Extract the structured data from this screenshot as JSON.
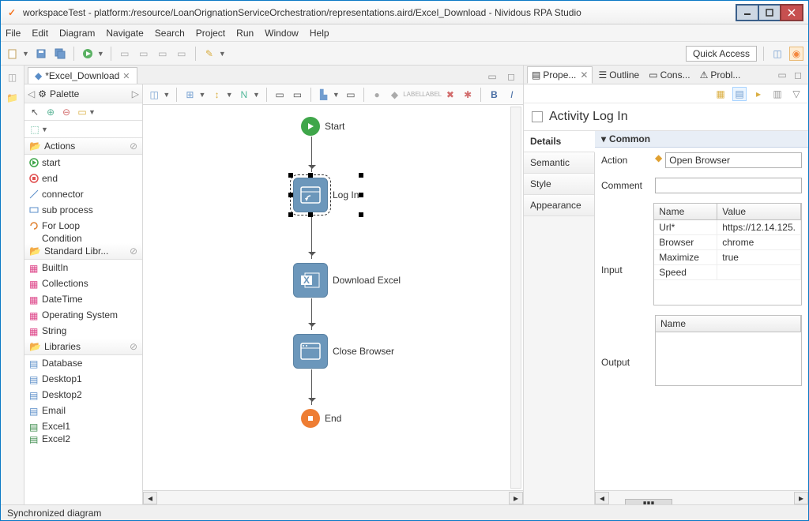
{
  "window": {
    "title": "workspaceTest - platform:/resource/LoanOrignationServiceOrchestration/representations.aird/Excel_Download - Nividous RPA Studio"
  },
  "menus": [
    "File",
    "Edit",
    "Diagram",
    "Navigate",
    "Search",
    "Project",
    "Run",
    "Window",
    "Help"
  ],
  "quick_access": "Quick Access",
  "editor_tab": "*Excel_Download",
  "palette": {
    "title": "Palette",
    "sections": {
      "actions": {
        "label": "Actions",
        "items": [
          "start",
          "end",
          "connector",
          "sub process",
          "For Loop",
          "Condition"
        ]
      },
      "stdlib": {
        "label": "Standard Libr...",
        "items": [
          "BuiltIn",
          "Collections",
          "DateTime",
          "Operating System",
          "String"
        ]
      },
      "libraries": {
        "label": "Libraries",
        "items": [
          "Database",
          "Desktop1",
          "Desktop2",
          "Email",
          "Excel1",
          "Excel2"
        ]
      }
    }
  },
  "flow": {
    "start": "Start",
    "login": "Log In",
    "download": "Download Excel",
    "close": "Close Browser",
    "end": "End"
  },
  "right": {
    "tabs": {
      "prop": "Prope...",
      "outline": "Outline",
      "cons": "Cons...",
      "probl": "Probl..."
    },
    "title": "Activity Log In",
    "ptabs": [
      "Details",
      "Semantic",
      "Style",
      "Appearance"
    ],
    "section": "Common",
    "action_label": "Action",
    "action_value": "Open Browser",
    "comment_label": "Comment",
    "comment_value": "",
    "input_label": "Input",
    "output_label": "Output",
    "cols": {
      "name": "Name",
      "value": "Value"
    },
    "inputs": [
      {
        "n": "Url*",
        "v": "https://12.14.125."
      },
      {
        "n": "Browser",
        "v": "chrome"
      },
      {
        "n": "Maximize",
        "v": "true"
      },
      {
        "n": "Speed",
        "v": ""
      }
    ],
    "out_cols": {
      "name": "Name"
    }
  },
  "status": "Synchronized diagram"
}
